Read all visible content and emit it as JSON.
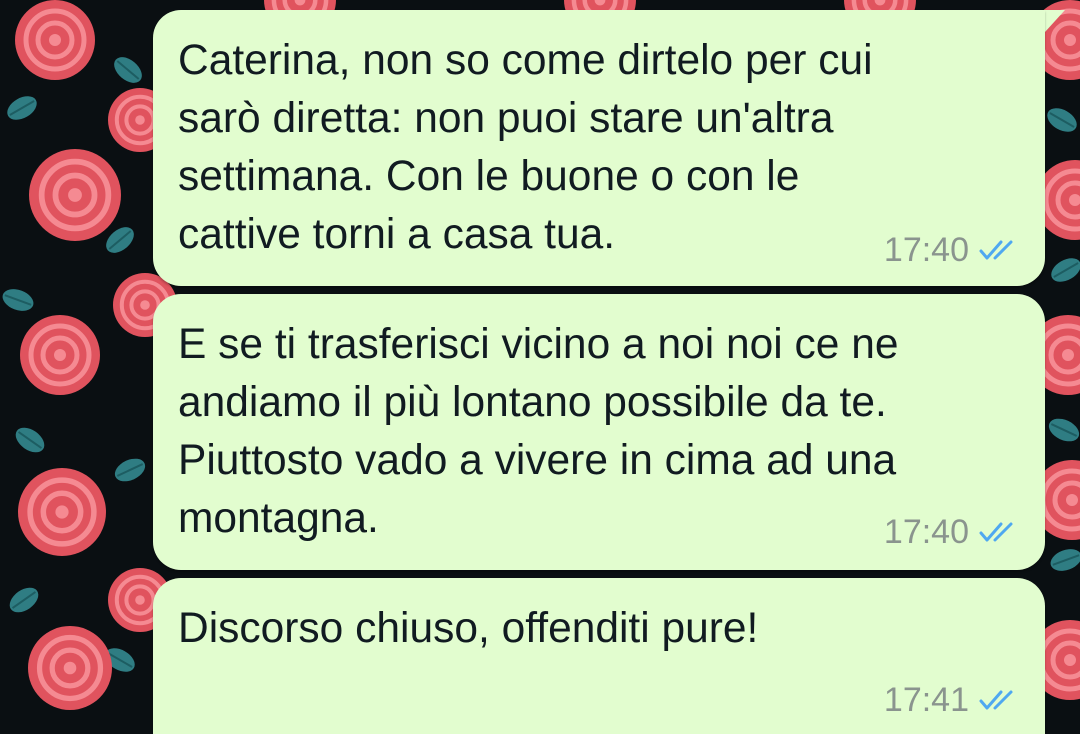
{
  "colors": {
    "bubble_background": "#e2fdcf",
    "text": "#111b21",
    "timestamp": "#8a948e",
    "read_ticks": "#4fa8f0",
    "wallpaper_background": "#0a0f12",
    "wallpaper_rose": "#e0535e",
    "wallpaper_leaf": "#2f7d83"
  },
  "messages": [
    {
      "text": "Caterina, non so come dirtelo per cui\nsarò diretta: non puoi stare un'altra\nsettimana. Con le buone o con le\ncattive torni a casa tua.",
      "time": "17:40",
      "status_icon": "double-check-read-icon"
    },
    {
      "text": "E se ti trasferisci vicino a noi noi ce ne\nandiamo il più lontano possibile da te.\nPiuttosto vado a vivere in cima ad una\nmontagna.",
      "time": "17:40",
      "status_icon": "double-check-read-icon"
    },
    {
      "text": "Discorso chiuso, offenditi pure!",
      "time": "17:41",
      "status_icon": "double-check-read-icon"
    }
  ]
}
